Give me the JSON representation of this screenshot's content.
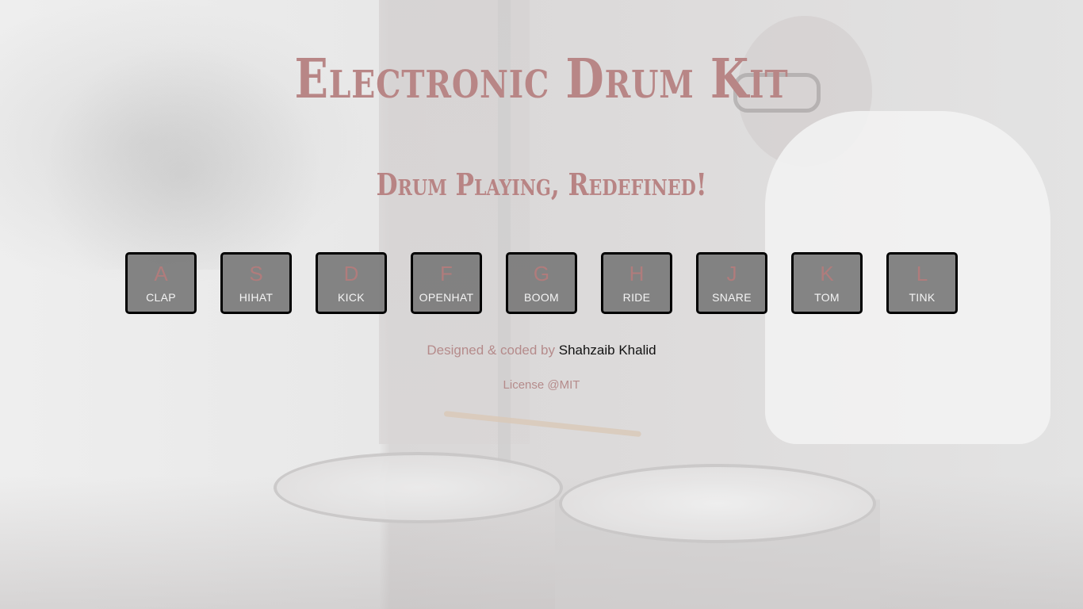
{
  "header": {
    "title": "Electronic Drum Kit",
    "subtitle": "Drum Playing, Redefined!"
  },
  "keys": [
    {
      "key": "A",
      "sound": "CLAP"
    },
    {
      "key": "S",
      "sound": "HIHAT"
    },
    {
      "key": "D",
      "sound": "KICK"
    },
    {
      "key": "F",
      "sound": "OPENHAT"
    },
    {
      "key": "G",
      "sound": "BOOM"
    },
    {
      "key": "H",
      "sound": "RIDE"
    },
    {
      "key": "J",
      "sound": "SNARE"
    },
    {
      "key": "K",
      "sound": "TOM"
    },
    {
      "key": "L",
      "sound": "TINK"
    }
  ],
  "footer": {
    "credit_prefix": "Designed & coded by",
    "author": "Shahzaib Khalid",
    "license": "License @MIT"
  },
  "colors": {
    "accent_text": "#b88686",
    "key_bg": "#787878",
    "key_border": "#000000",
    "key_sound_text": "#f4f4f4"
  }
}
